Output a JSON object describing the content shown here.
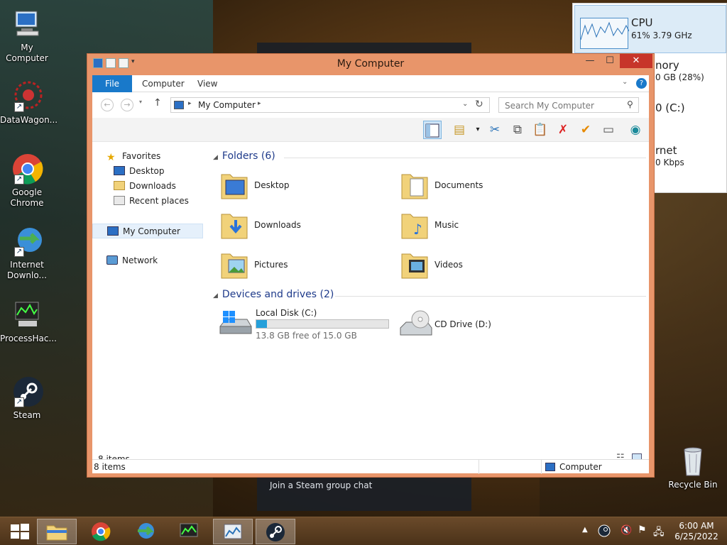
{
  "desktop": {
    "icons": [
      {
        "label": "My Computer",
        "icon": "computer-icon"
      },
      {
        "label": "DataWagon...",
        "icon": "datawagon-icon"
      },
      {
        "label": "Google Chrome",
        "icon": "chrome-icon"
      },
      {
        "label": "Internet Downlo...",
        "icon": "idm-icon"
      },
      {
        "label": "ProcessHac...",
        "icon": "processhacker-icon"
      },
      {
        "label": "Steam",
        "icon": "steam-icon"
      },
      {
        "label": "Recycle Bin",
        "icon": "recycle-bin-icon"
      }
    ],
    "steam_chat_text": "Join a Steam group chat"
  },
  "taskmgr": {
    "cpu_label": "CPU",
    "cpu_value": "61%  3.79 GHz",
    "memory_label": "nory",
    "memory_value": "0 GB (28%)",
    "disk_label": "0 (C:)",
    "net_label": "rnet",
    "net_value": "0 Kbps"
  },
  "window": {
    "title": "My Computer",
    "min": "—",
    "max": "☐",
    "close": "✕",
    "tabs": {
      "file": "File",
      "computer": "Computer",
      "view": "View"
    },
    "address": "My Computer",
    "search_placeholder": "Search My Computer",
    "nav": {
      "favorites": "Favorites",
      "desktop": "Desktop",
      "downloads": "Downloads",
      "recent": "Recent places",
      "my_computer": "My Computer",
      "network": "Network"
    },
    "folders_header": "Folders (6)",
    "folders": [
      "Desktop",
      "Documents",
      "Downloads",
      "Music",
      "Pictures",
      "Videos"
    ],
    "devices_header": "Devices and drives (2)",
    "drive_c": {
      "name": "Local Disk (C:)",
      "free": "13.8 GB free of 15.0 GB",
      "used_fraction": 0.08
    },
    "drive_d": {
      "name": "CD Drive (D:)"
    },
    "items_count": "8 items",
    "status_left": "8 items",
    "status_right": "Computer"
  },
  "taskbar": {
    "time": "6:00 AM",
    "date": "6/25/2022"
  },
  "colors": {
    "titlebar": "#e8956a",
    "accent": "#1979ca",
    "close": "#c7352a"
  }
}
